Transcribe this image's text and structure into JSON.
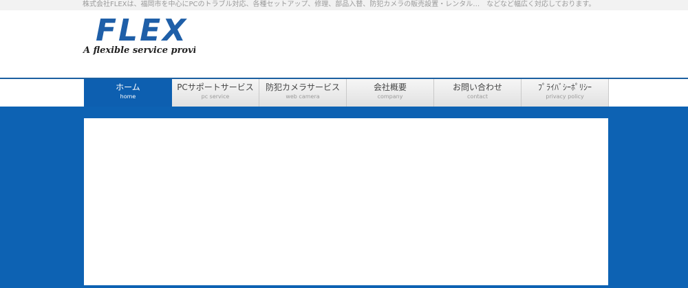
{
  "topbar": {
    "text": "株式会社FLEXは、福岡市を中心にPCのトラブル対応、各種セットアップ、修理、部品入替、防犯カメラの販売設置・レンタル…　などなど幅広く対応しております。"
  },
  "logo": {
    "wordmark": "FLEX",
    "tagline": "A flexible service provider"
  },
  "nav": {
    "items": [
      {
        "label": "ホーム",
        "sub": "home",
        "active": true
      },
      {
        "label": "PCサポートサービス",
        "sub": "pc service",
        "active": false
      },
      {
        "label": "防犯カメラサービス",
        "sub": "web camera",
        "active": false
      },
      {
        "label": "会社概要",
        "sub": "company",
        "active": false
      },
      {
        "label": "お問い合わせ",
        "sub": "contact",
        "active": false
      },
      {
        "label": "ﾌﾟﾗｲﾊﾞｼｰﾎﾟﾘｼｰ",
        "sub": "privacy policy",
        "active": false
      }
    ]
  },
  "colors": {
    "brand_blue": "#0d62b3",
    "header_rule": "#1a5fa0",
    "nav_active": "#0d5fb0"
  }
}
